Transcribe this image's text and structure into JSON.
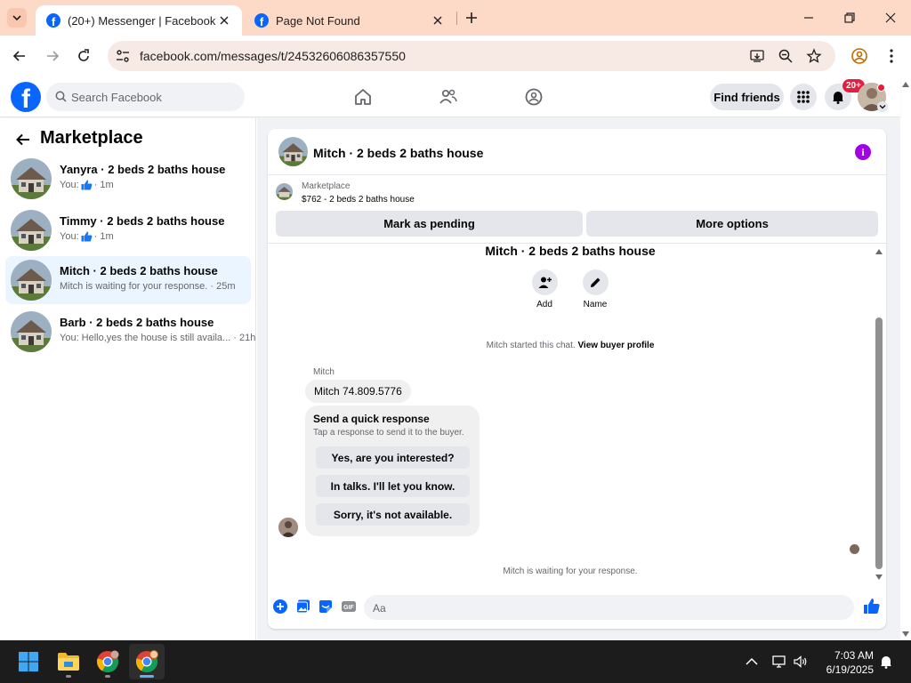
{
  "browser": {
    "tabs": [
      {
        "title": "(20+) Messenger | Facebook",
        "active": true
      },
      {
        "title": "Page Not Found",
        "active": false
      }
    ],
    "url": "facebook.com/messages/t/24532606086357550"
  },
  "fb_header": {
    "logo": "f",
    "search_placeholder": "Search Facebook",
    "find_friends": "Find friends",
    "notif_badge": "20+"
  },
  "left_panel": {
    "title": "Marketplace",
    "conversations": [
      {
        "name": "Yanyra · 2 beds 2 baths house",
        "preview_prefix": "You:",
        "preview_text": "",
        "preview_like": true,
        "time": "· 1m",
        "selected": false
      },
      {
        "name": "Timmy · 2 beds 2 baths house",
        "preview_prefix": "You:",
        "preview_text": "",
        "preview_like": true,
        "time": "· 1m",
        "selected": false
      },
      {
        "name": "Mitch · 2 beds 2 baths house",
        "preview_prefix": "",
        "preview_text": "Mitch is waiting for your response.",
        "preview_like": false,
        "time": "· 25m",
        "selected": true
      },
      {
        "name": "Barb · 2 beds 2 baths house",
        "preview_prefix": "",
        "preview_text": "You: Hello,yes the house is still availa...",
        "preview_like": false,
        "time": "· 21h",
        "selected": false
      }
    ]
  },
  "chat": {
    "title": "Mitch · 2 beds 2 baths house",
    "marketplace_label": "Marketplace",
    "listing_price": "$762 - 2 beds 2 baths house",
    "mark_pending": "Mark as pending",
    "more_options": "More options",
    "intro_title": "Mitch · 2 beds 2 baths house",
    "actions": [
      {
        "label": "Add"
      },
      {
        "label": "Name"
      }
    ],
    "started_text": "Mitch started this chat.",
    "view_profile": "View buyer profile",
    "sender_name": "Mitch",
    "message": "Mitch 74.809.5776",
    "quick_response": {
      "title": "Send a quick response",
      "subtitle": "Tap a response to send it to the buyer.",
      "options": [
        "Yes, are you interested?",
        "In talks. I'll let you know.",
        "Sorry, it's not available."
      ]
    },
    "waiting_text": "Mitch is waiting for your response.",
    "composer_placeholder": "Aa"
  },
  "taskbar": {
    "time": "7:03 AM",
    "date": "6/19/2025"
  },
  "colors": {
    "fb_blue": "#0866ff",
    "selected_bg": "#ebf5ff",
    "info_purple": "#a200e6",
    "badge_red": "#e41e3f",
    "tabbar_bg": "#fdd9c8"
  }
}
